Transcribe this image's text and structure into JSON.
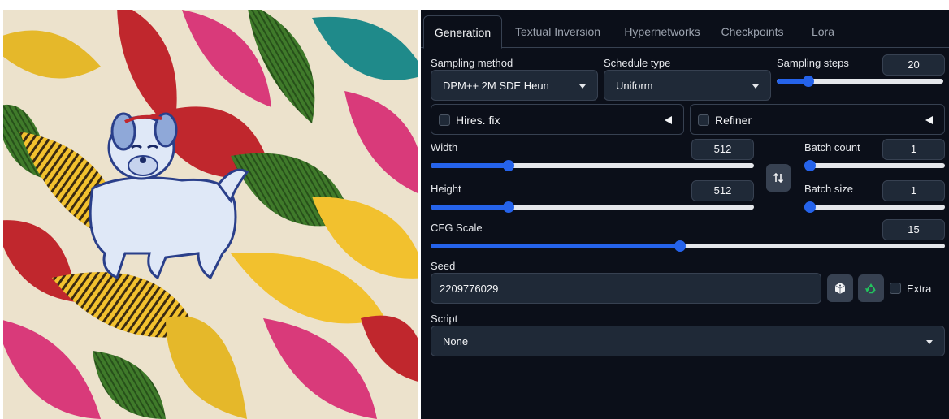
{
  "tabs": [
    {
      "label": "Generation",
      "active": true
    },
    {
      "label": "Textual Inversion",
      "active": false
    },
    {
      "label": "Hypernetworks",
      "active": false
    },
    {
      "label": "Checkpoints",
      "active": false
    },
    {
      "label": "Lora",
      "active": false
    }
  ],
  "sampling_method": {
    "label": "Sampling method",
    "value": "DPM++ 2M SDE Heun"
  },
  "schedule_type": {
    "label": "Schedule type",
    "value": "Uniform"
  },
  "sampling_steps": {
    "label": "Sampling steps",
    "value": "20",
    "fraction": 0.19
  },
  "hires_fix": {
    "label": "Hires. fix",
    "checked": false
  },
  "refiner": {
    "label": "Refiner",
    "checked": false
  },
  "width": {
    "label": "Width",
    "value": "512",
    "fraction": 0.24
  },
  "height": {
    "label": "Height",
    "value": "512",
    "fraction": 0.24
  },
  "batch_count": {
    "label": "Batch count",
    "value": "1",
    "fraction": 0.0
  },
  "batch_size": {
    "label": "Batch size",
    "value": "1",
    "fraction": 0.0
  },
  "cfg_scale": {
    "label": "CFG Scale",
    "value": "15",
    "fraction": 0.485
  },
  "seed": {
    "label": "Seed",
    "value": "2209776029",
    "extra_label": "Extra",
    "extra_checked": false
  },
  "script": {
    "label": "Script",
    "value": "None"
  },
  "colors": {
    "accent": "#2563eb",
    "panel_bg": "#0b0f19",
    "input_bg": "#1f2937",
    "recycle": "#22c55e"
  },
  "icons": [
    "swap-icon",
    "dice-icon",
    "recycle-icon",
    "triangle-left-icon",
    "caret-down-icon"
  ]
}
